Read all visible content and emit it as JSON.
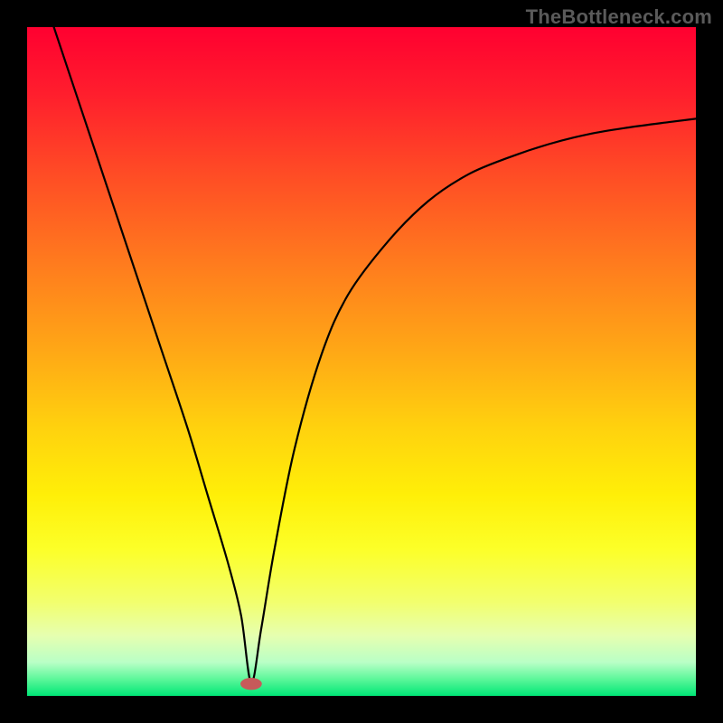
{
  "watermark": "TheBottleneck.com",
  "gradient": {
    "stops": [
      {
        "offset": 0.0,
        "color": "#ff0030"
      },
      {
        "offset": 0.1,
        "color": "#ff1e2d"
      },
      {
        "offset": 0.22,
        "color": "#ff4c25"
      },
      {
        "offset": 0.35,
        "color": "#ff7a1e"
      },
      {
        "offset": 0.48,
        "color": "#ffa616"
      },
      {
        "offset": 0.6,
        "color": "#ffd20e"
      },
      {
        "offset": 0.7,
        "color": "#ffef08"
      },
      {
        "offset": 0.78,
        "color": "#fcff28"
      },
      {
        "offset": 0.86,
        "color": "#f2ff6e"
      },
      {
        "offset": 0.91,
        "color": "#e6ffb0"
      },
      {
        "offset": 0.95,
        "color": "#b9ffc6"
      },
      {
        "offset": 0.975,
        "color": "#5cf79a"
      },
      {
        "offset": 1.0,
        "color": "#00e676"
      }
    ]
  },
  "marker": {
    "cx": 0.335,
    "cy": 0.982,
    "rx": 0.016,
    "ry": 0.009,
    "fill": "#c75a5a"
  },
  "curve_style": {
    "stroke": "#000000",
    "width": 2.2
  },
  "chart_data": {
    "type": "line",
    "title": "",
    "xlabel": "",
    "ylabel": "",
    "xlim": [
      0,
      100
    ],
    "ylim": [
      0,
      100
    ],
    "series": [
      {
        "name": "curve",
        "x": [
          4,
          8,
          12,
          16,
          20,
          24,
          27,
          30,
          32,
          33.5,
          35,
          37,
          40,
          44,
          48,
          54,
          60,
          66,
          72,
          78,
          84,
          90,
          96,
          100
        ],
        "y": [
          100,
          88,
          76,
          64,
          52,
          40,
          30,
          20,
          12,
          2,
          10,
          22,
          37,
          51,
          60,
          68,
          74,
          78,
          80.5,
          82.5,
          84,
          85,
          85.8,
          86.3
        ]
      }
    ],
    "minimum_marker": {
      "x": 33.5,
      "y": 2
    }
  }
}
